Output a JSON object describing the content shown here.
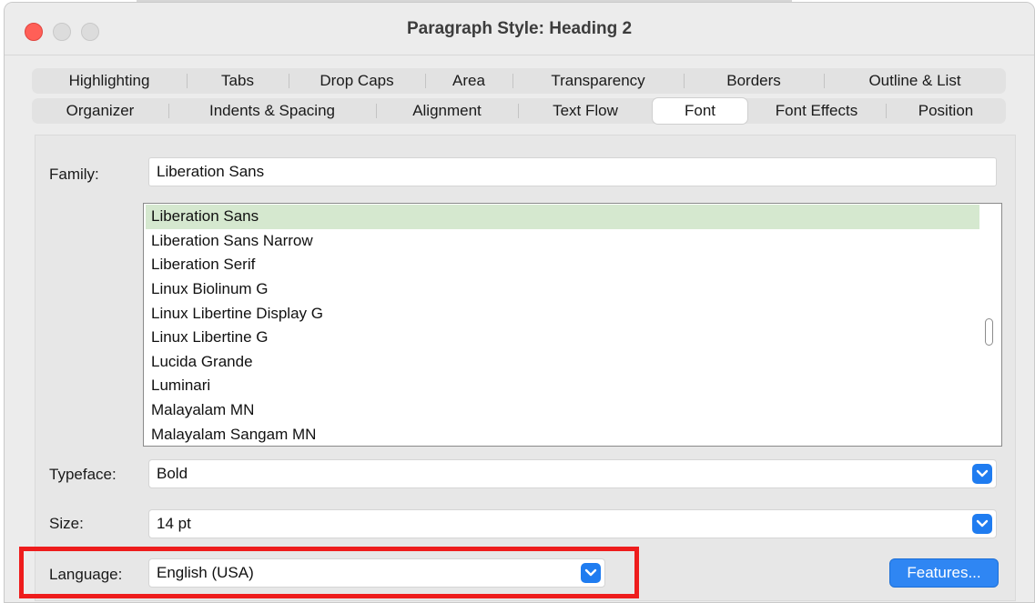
{
  "window": {
    "title": "Paragraph Style: Heading 2"
  },
  "tabs_row1": [
    "Highlighting",
    "Tabs",
    "Drop Caps",
    "Area",
    "Transparency",
    "Borders",
    "Outline & List"
  ],
  "tabs_row2": [
    "Organizer",
    "Indents & Spacing",
    "Alignment",
    "Text Flow",
    "Font",
    "Font Effects",
    "Position"
  ],
  "active_tab": "Font",
  "font": {
    "family_label": "Family:",
    "family_value": "Liberation Sans",
    "family_list": [
      "Liberation Sans",
      "Liberation Sans Narrow",
      "Liberation Serif",
      "Linux Biolinum G",
      "Linux Libertine Display G",
      "Linux Libertine G",
      "Lucida Grande",
      "Luminari",
      "Malayalam MN",
      "Malayalam Sangam MN"
    ],
    "selected_family": "Liberation Sans",
    "typeface_label": "Typeface:",
    "typeface_value": "Bold",
    "size_label": "Size:",
    "size_value": "14 pt",
    "language_label": "Language:",
    "language_value": "English (USA)",
    "features_label": "Features..."
  },
  "colors": {
    "accent": "#1f7cf0",
    "selection": "#d5e8cf",
    "highlight_box": "#ee1c1c",
    "close_button": "#ff5f57"
  }
}
